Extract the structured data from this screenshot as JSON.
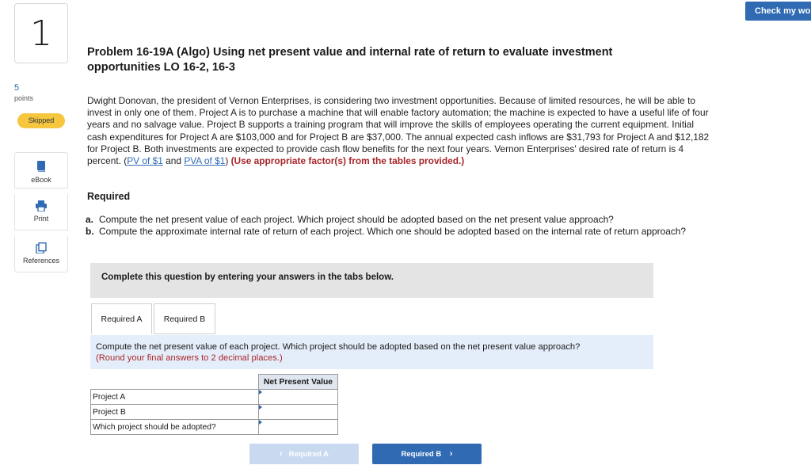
{
  "header": {
    "check_button": "Check my wo"
  },
  "sidebar": {
    "question_number": "1",
    "points_value": "5",
    "points_label": "points",
    "status_badge": "Skipped",
    "tools": [
      {
        "label": "eBook",
        "icon": "ebook-icon"
      },
      {
        "label": "Print",
        "icon": "print-icon"
      },
      {
        "label": "References",
        "icon": "references-icon"
      }
    ]
  },
  "problem": {
    "title": "Problem 16-19A (Algo) Using net present value and internal rate of return to evaluate investment opportunities LO 16-2, 16-3",
    "description": "Dwight Donovan, the president of Vernon Enterprises, is considering two investment opportunities. Because of limited resources, he will be able to invest in only one of them. Project A is to purchase a machine that will enable factory automation; the machine is expected to have a useful life of four years and no salvage value. Project B supports a training program that will improve the skills of employees operating the current equipment. Initial cash expenditures for Project A are $103,000 and for Project B are $37,000. The annual expected cash inflows are $31,793 for Project A and $12,182 for Project B. Both investments are expected to provide cash flow benefits for the next four years. Vernon Enterprises' desired rate of return is 4 percent. (",
    "link_pv": "PV of $1",
    "and_text": " and ",
    "link_pva": "PVA of $1",
    "close_paren": ") ",
    "instruction_red": "(Use appropriate factor(s) from the tables provided.)",
    "required_heading": "Required",
    "requirements": [
      {
        "key": "a.",
        "text": "Compute the net present value of each project. Which project should be adopted based on the net present value approach?"
      },
      {
        "key": "b.",
        "text": "Compute the approximate internal rate of return of each project. Which one should be adopted based on the internal rate of return approach?"
      }
    ]
  },
  "answer_area": {
    "complete_text": "Complete this question by entering your answers in the tabs below.",
    "tabs": [
      "Required A",
      "Required B"
    ],
    "instruction": "Compute the net present value of each project. Which project should be adopted based on the net present value approach?",
    "instruction_note": "(Round your final answers to 2 decimal places.)",
    "table": {
      "column_header": "Net Present Value",
      "rows": [
        "Project A",
        "Project B",
        "Which project should be adopted?"
      ],
      "values": [
        "",
        "",
        ""
      ]
    },
    "nav_prev": "Required A",
    "nav_next": "Required B"
  },
  "colors": {
    "accent": "#2f6ab3",
    "badge": "#f6c63f",
    "note_red": "#a8262a"
  }
}
